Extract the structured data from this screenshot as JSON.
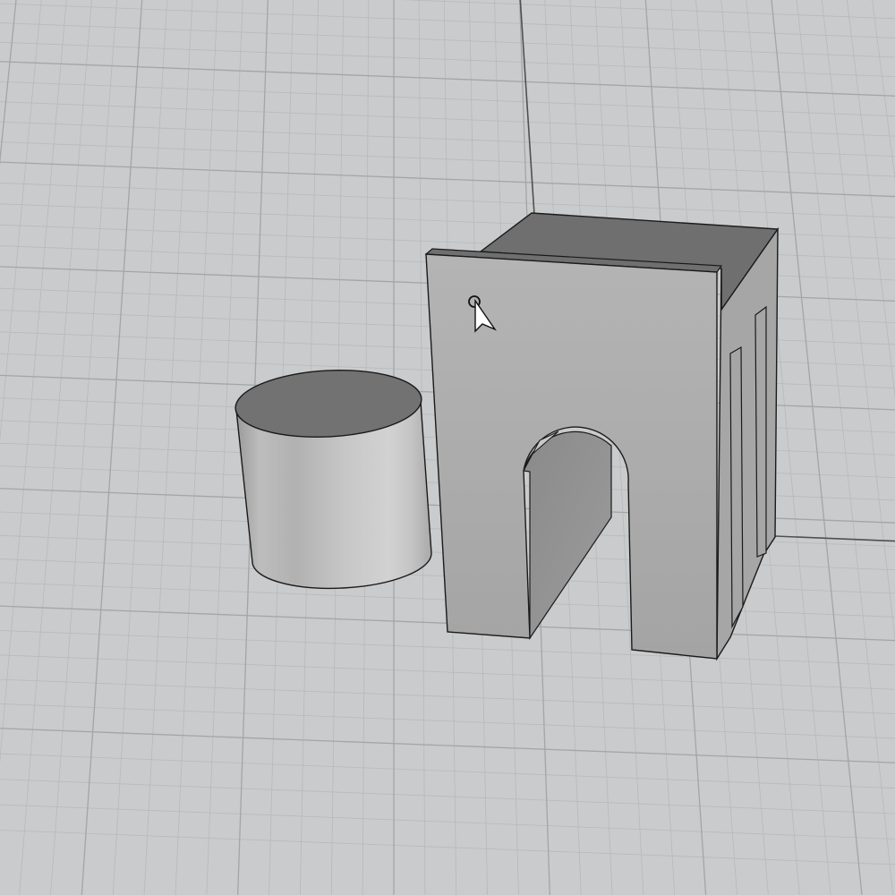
{
  "viewport": {
    "view": "perspective",
    "display_mode": "shaded",
    "background_color": "#c9cbcc",
    "grid": {
      "visible": true,
      "minor_line_color": "#b7b9ba",
      "major_line_color": "#a3a5a6",
      "axis_line_color": "#505050"
    }
  },
  "objects": [
    {
      "type": "cylinder",
      "top_color": "#727272",
      "side_color": "#c3c3c3",
      "edge_color": "#1a1a1a"
    },
    {
      "type": "arch-block",
      "front_color": "#ababab",
      "top_color": "#6f6f6f",
      "side_color": "#a6a6a6",
      "inner_color": "#808080",
      "edge_color": "#1a1a1a"
    }
  ],
  "cursor": {
    "type": "arrow-with-snap-circle",
    "fill_color": "#ffffff",
    "outline_color": "#111111"
  }
}
